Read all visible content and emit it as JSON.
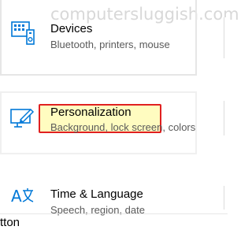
{
  "watermark": "computersluggish.com",
  "settings": {
    "items": [
      {
        "title": "Devices",
        "subtitle": "Bluetooth, printers, mouse",
        "icon": "devices-icon"
      },
      {
        "title": "Personalization",
        "subtitle": "Background, lock screen, colors",
        "icon": "personalization-icon"
      },
      {
        "title": "Time & Language",
        "subtitle": "Speech, region, date",
        "icon": "time-language-icon"
      }
    ]
  },
  "fragment_text": "tton",
  "colors": {
    "accent": "#0078d7",
    "highlight_border": "#e02020",
    "highlight_fill": "#fffa8c"
  }
}
